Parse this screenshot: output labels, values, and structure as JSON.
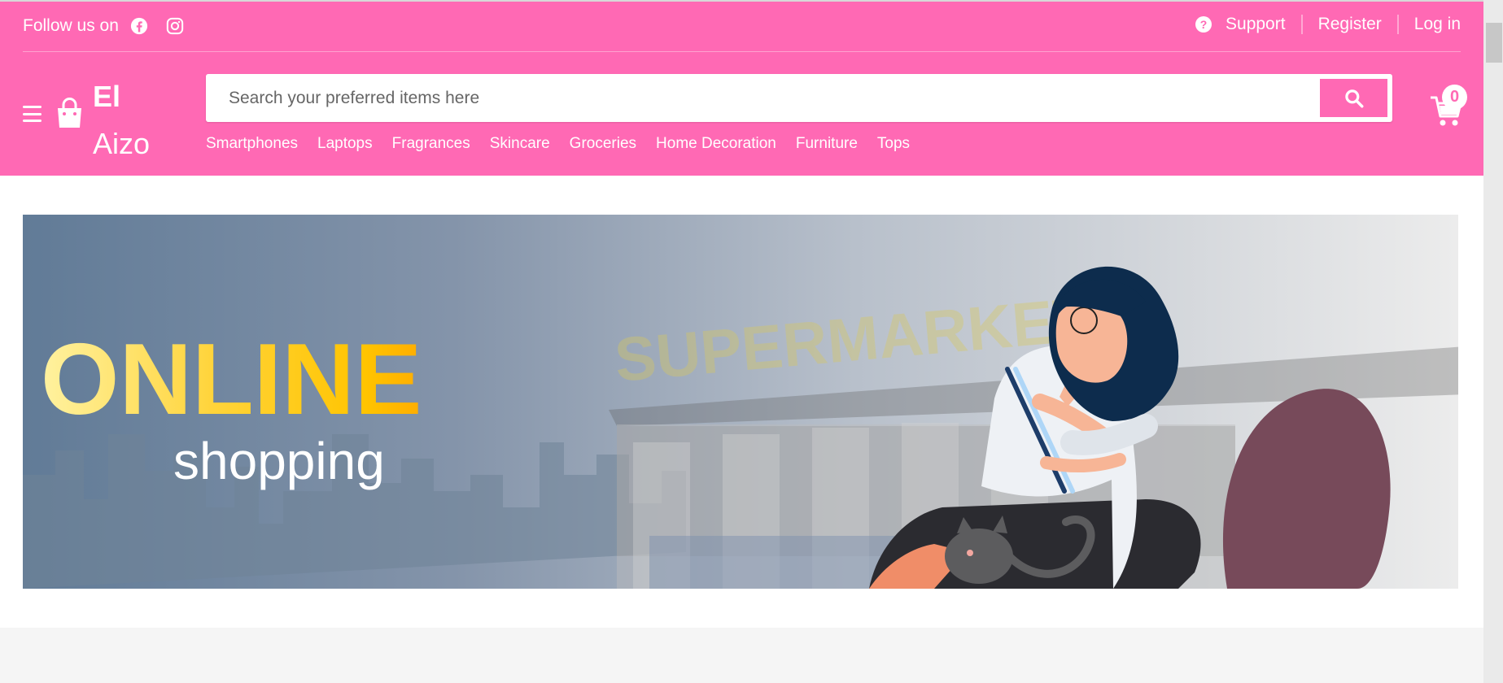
{
  "header": {
    "follow_label": "Follow us on",
    "social_icons": [
      "facebook-icon",
      "instagram-icon"
    ],
    "links": {
      "support": "Support",
      "register": "Register",
      "login": "Log in"
    },
    "brand": {
      "line1": "El",
      "line2": "Aizo"
    },
    "search": {
      "placeholder": "Search your preferred items here"
    },
    "cart_count": "0",
    "categories": [
      "Smartphones",
      "Laptops",
      "Fragrances",
      "Skincare",
      "Groceries",
      "Home Decoration",
      "Furniture",
      "Tops"
    ]
  },
  "banner": {
    "headline": "ONLINE",
    "subline": "shopping",
    "background_text": "SUPERMARKET"
  },
  "colors": {
    "brand_pink": "#ff69b4",
    "headline_yellow": "#ffc400",
    "background": "#f5f5f5"
  }
}
